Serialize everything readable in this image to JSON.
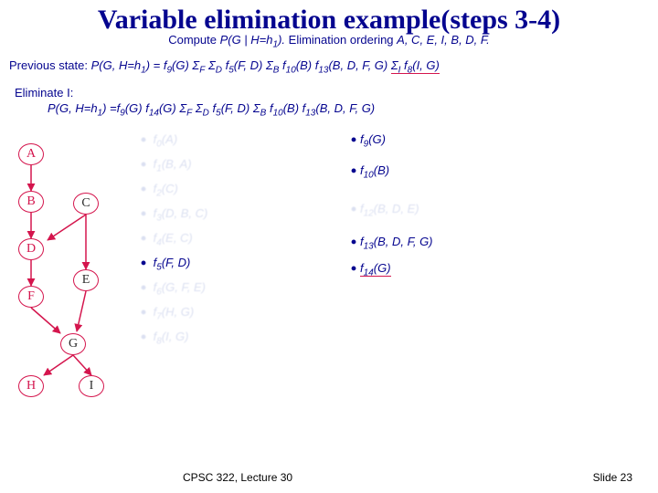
{
  "title": "Variable elimination example(steps 3-4)",
  "subtitle_prefix": "Compute ",
  "subtitle_pfg": "P(G | H=h",
  "subtitle_pfg_sub": "1",
  "subtitle_pfg_close": ").",
  "subtitle_rest": " Elimination ordering ",
  "subtitle_order": "A, C, E, I, B, D, F.",
  "prev_label": "Previous state:  ",
  "prev_expr_a": "P(G, H=h",
  "prev_sub1": "1",
  "prev_expr_b": ") = f",
  "prev_sub9": "9",
  "prev_expr_c": "(G) Σ",
  "prev_sigF": "F",
  "prev_expr_d": " Σ",
  "prev_sigD": "D",
  "prev_expr_e": " f",
  "prev_sub5": "5",
  "prev_expr_f": "(F, D) Σ",
  "prev_sigB": "B",
  "prev_expr_g": " f",
  "prev_sub10": "10",
  "prev_expr_h": "(B) f",
  "prev_sub13": "13",
  "prev_expr_i": "(B, D, F, G) ",
  "prev_under_a": "Σ",
  "prev_under_I": "I",
  "prev_under_b": " f",
  "prev_under_8": "8",
  "prev_under_c": "(I, G)",
  "elim_head": "Eliminate I:",
  "elim_a": "P(G, H=h",
  "elim_sub1": "1",
  "elim_b": ") =f",
  "elim_sub9": "9",
  "elim_c": "(G) f",
  "elim_sub14": "14",
  "elim_d": "(G) Σ",
  "elim_sigF": "F",
  "elim_e": " Σ",
  "elim_sigD": "D",
  "elim_f": " f",
  "elim_sub5": "5",
  "elim_g": "(F, D) Σ",
  "elim_sigB": "B",
  "elim_h": " f",
  "elim_sub10": "10",
  "elim_i": "(B) f",
  "elim_sub13": "13",
  "elim_j": "(B, D, F, G)",
  "nodes": {
    "A": "A",
    "B": "B",
    "C": "C",
    "D": "D",
    "E": "E",
    "F": "F",
    "G": "G",
    "H": "H",
    "I": "I"
  },
  "factors_left": [
    {
      "txt_a": "f",
      "sub": "0",
      "txt_b": "(A)",
      "crisp": false
    },
    {
      "txt_a": "f",
      "sub": "1",
      "txt_b": "(B, A)",
      "crisp": false
    },
    {
      "txt_a": "f",
      "sub": "2",
      "txt_b": "(C)",
      "crisp": false
    },
    {
      "txt_a": "f",
      "sub": "3",
      "txt_b": "(D, B, C)",
      "crisp": false
    },
    {
      "txt_a": "f",
      "sub": "4",
      "txt_b": "(E, C)",
      "crisp": false
    },
    {
      "txt_a": "f",
      "sub": "5",
      "txt_b": "(F, D)",
      "crisp": true
    },
    {
      "txt_a": "f",
      "sub": "6",
      "txt_b": "(G, F, E)",
      "crisp": false
    },
    {
      "txt_a": "f",
      "sub": "7",
      "txt_b": "(H, G)",
      "crisp": false
    },
    {
      "txt_a": "f",
      "sub": "8",
      "txt_b": "(I, G)",
      "crisp": false
    }
  ],
  "factors_right": [
    {
      "txt_a": "f",
      "sub": "9",
      "txt_b": "(G)",
      "crisp": true,
      "under": false
    },
    {
      "txt_a": "f",
      "sub": "10",
      "txt_b": "(B)",
      "crisp": true,
      "under": false
    },
    {
      "txt_a": "f",
      "sub": "12",
      "txt_b": "(B, D, E)",
      "crisp": false,
      "under": false
    },
    {
      "txt_a": "f",
      "sub": "13",
      "txt_b": "(B, D, F, G)",
      "crisp": true,
      "under": false
    },
    {
      "txt_a": "f",
      "sub": "14",
      "txt_b": "(G)",
      "crisp": true,
      "under": true
    }
  ],
  "footer_center": "CPSC 322, Lecture 30",
  "footer_right": "Slide 23"
}
